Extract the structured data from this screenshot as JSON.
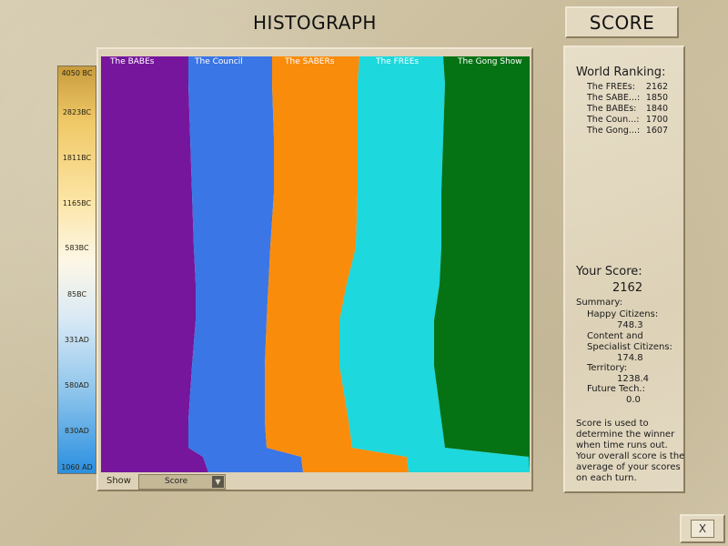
{
  "titles": {
    "histograph": "HISTOGRAPH",
    "score": "SCORE"
  },
  "axis": {
    "ticks": [
      "4050 BC",
      "2823BC",
      "1811BC",
      "1165BC",
      "583BC",
      "85BC",
      "331AD",
      "580AD",
      "830AD",
      "1060 AD"
    ]
  },
  "civs": [
    {
      "name": "The BABEs",
      "color": "#75169c"
    },
    {
      "name": "The Council",
      "color": "#3a76e6"
    },
    {
      "name": "The SABERs",
      "color": "#fa8c0c"
    },
    {
      "name": "The FREEs",
      "color": "#1dd8dc"
    },
    {
      "name": "The Gong Show",
      "color": "#057214"
    }
  ],
  "controls": {
    "show_label": "Show",
    "show_value": "Score",
    "dropdown_icon": "chevron-down-icon",
    "close_label": "X"
  },
  "ranking": {
    "title": "World Ranking:",
    "rows": [
      {
        "name": "The FREEs:",
        "score": "2162"
      },
      {
        "name": "The SABE...:",
        "score": "1850"
      },
      {
        "name": "The BABEs:",
        "score": "1840"
      },
      {
        "name": "The Coun...:",
        "score": "1700"
      },
      {
        "name": "The Gong...:",
        "score": "1607"
      }
    ]
  },
  "your_score": {
    "title": "Your Score:",
    "value": "2162",
    "summary_label": "Summary:",
    "happy_label": "Happy Citizens:",
    "happy_value": "748.3",
    "content_label_1": "Content and",
    "content_label_2": "Specialist Citizens:",
    "content_value": "174.8",
    "territory_label": "Territory:",
    "territory_value": "1238.4",
    "future_label": "Future Tech.:",
    "future_value": "0.0"
  },
  "note": {
    "line1": "Score is used to",
    "line2": "determine the winner",
    "line3": "when time runs out.",
    "line4": "Your overall score is the",
    "line5": "average of your scores",
    "line6": "on each turn."
  }
}
